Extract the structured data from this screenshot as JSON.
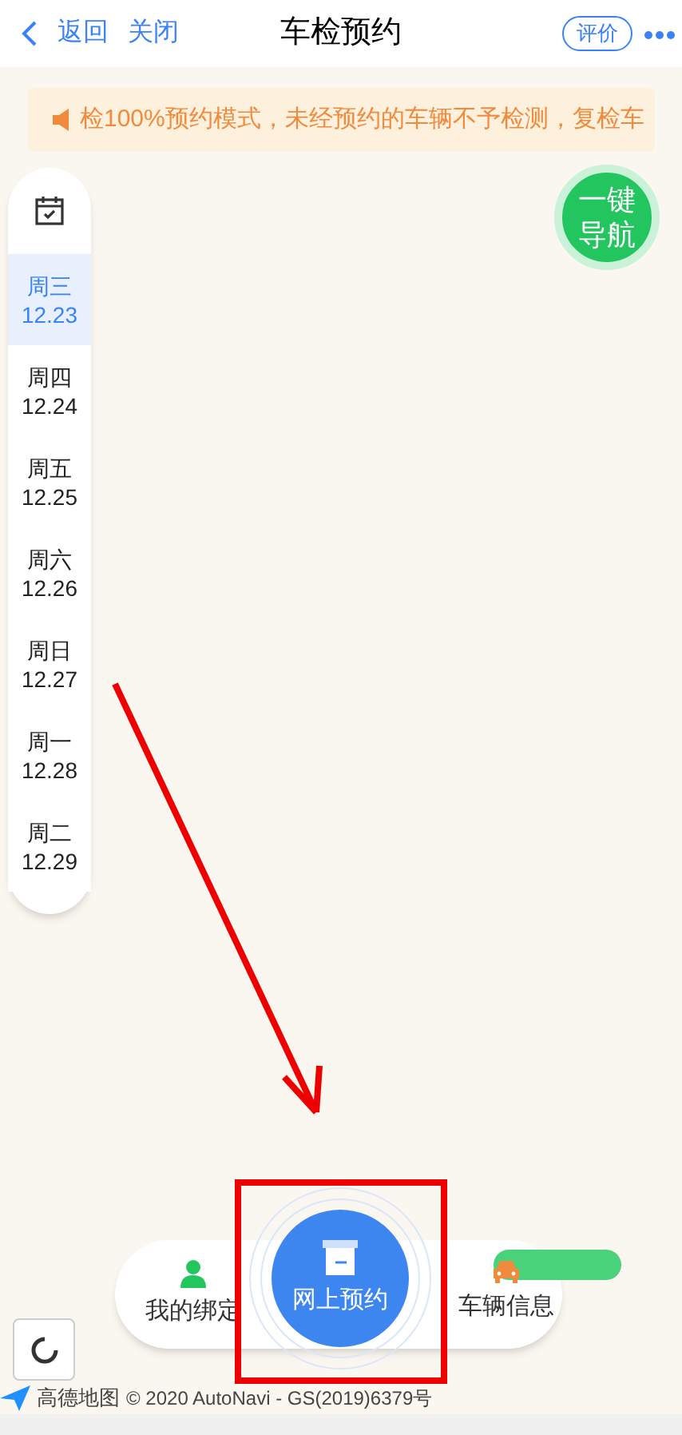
{
  "header": {
    "back": "返回",
    "close": "关闭",
    "title": "车检预约",
    "rate": "评价"
  },
  "notice": {
    "text": "检100%预约模式，未经预约的车辆不予检测，复检车"
  },
  "days": [
    {
      "weekday": "周三",
      "date": "12.23",
      "selected": true
    },
    {
      "weekday": "周四",
      "date": "12.24",
      "selected": false
    },
    {
      "weekday": "周五",
      "date": "12.25",
      "selected": false
    },
    {
      "weekday": "周六",
      "date": "12.26",
      "selected": false
    },
    {
      "weekday": "周日",
      "date": "12.27",
      "selected": false
    },
    {
      "weekday": "周一",
      "date": "12.28",
      "selected": false
    },
    {
      "weekday": "周二",
      "date": "12.29",
      "selected": false
    }
  ],
  "navigate_button": {
    "line_1": "一键",
    "line_2": "导航"
  },
  "bottom_bar": {
    "left": "我的绑定",
    "center": "网上预约",
    "right": "车辆信息"
  },
  "map_footer": {
    "brand": "高德地图",
    "copyright": "© 2020 AutoNavi - GS(2019)6379号"
  }
}
